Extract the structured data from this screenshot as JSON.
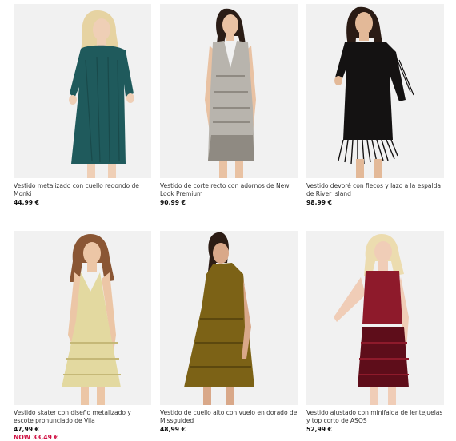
{
  "products": [
    {
      "title": "Vestido metalizado con cuello redondo de Monki",
      "price": "44,99 €",
      "now_price": null,
      "colors": {
        "dress": "#1f5a5c",
        "dress_shade": "#15403f",
        "hair": "#e6d3a2",
        "skin": "#efcfb6"
      }
    },
    {
      "title": "Vestido de corte recto con adornos de New Look Premium",
      "price": "90,99 €",
      "now_price": null,
      "colors": {
        "dress": "#b8b4ad",
        "dress_shade": "#8f8a82",
        "hair": "#2b1d16",
        "skin": "#e9c2a3"
      }
    },
    {
      "title": "Vestido devoré con flecos y lazo a la espalda de River Island",
      "price": "98,99 €",
      "now_price": null,
      "colors": {
        "dress": "#141212",
        "dress_shade": "#000000",
        "hair": "#2a1b14",
        "skin": "#e3b998"
      }
    },
    {
      "title": "Vestido skater con diseño metalizado y escote pronunciado de Vila",
      "price": "47,99 €",
      "now_price": "NOW 33,49 €",
      "colors": {
        "dress": "#e3d9a0",
        "dress_shade": "#c5b877",
        "hair": "#8a5634",
        "skin": "#ecc6a6"
      }
    },
    {
      "title": "Vestido de cuello alto con vuelo en dorado de Missguided",
      "price": "48,99 €",
      "now_price": null,
      "colors": {
        "dress": "#7c6216",
        "dress_shade": "#4f3d0c",
        "hair": "#2c1c14",
        "skin": "#d9a889"
      }
    },
    {
      "title": "Vestido ajustado con minifalda de lentejuelas y top corto de ASOS",
      "price": "52,99 €",
      "now_price": null,
      "colors": {
        "dress": "#8e1a2b",
        "dress_shade": "#5e0d1a",
        "hair": "#ecdcaf",
        "skin": "#f0cdb7"
      }
    }
  ]
}
